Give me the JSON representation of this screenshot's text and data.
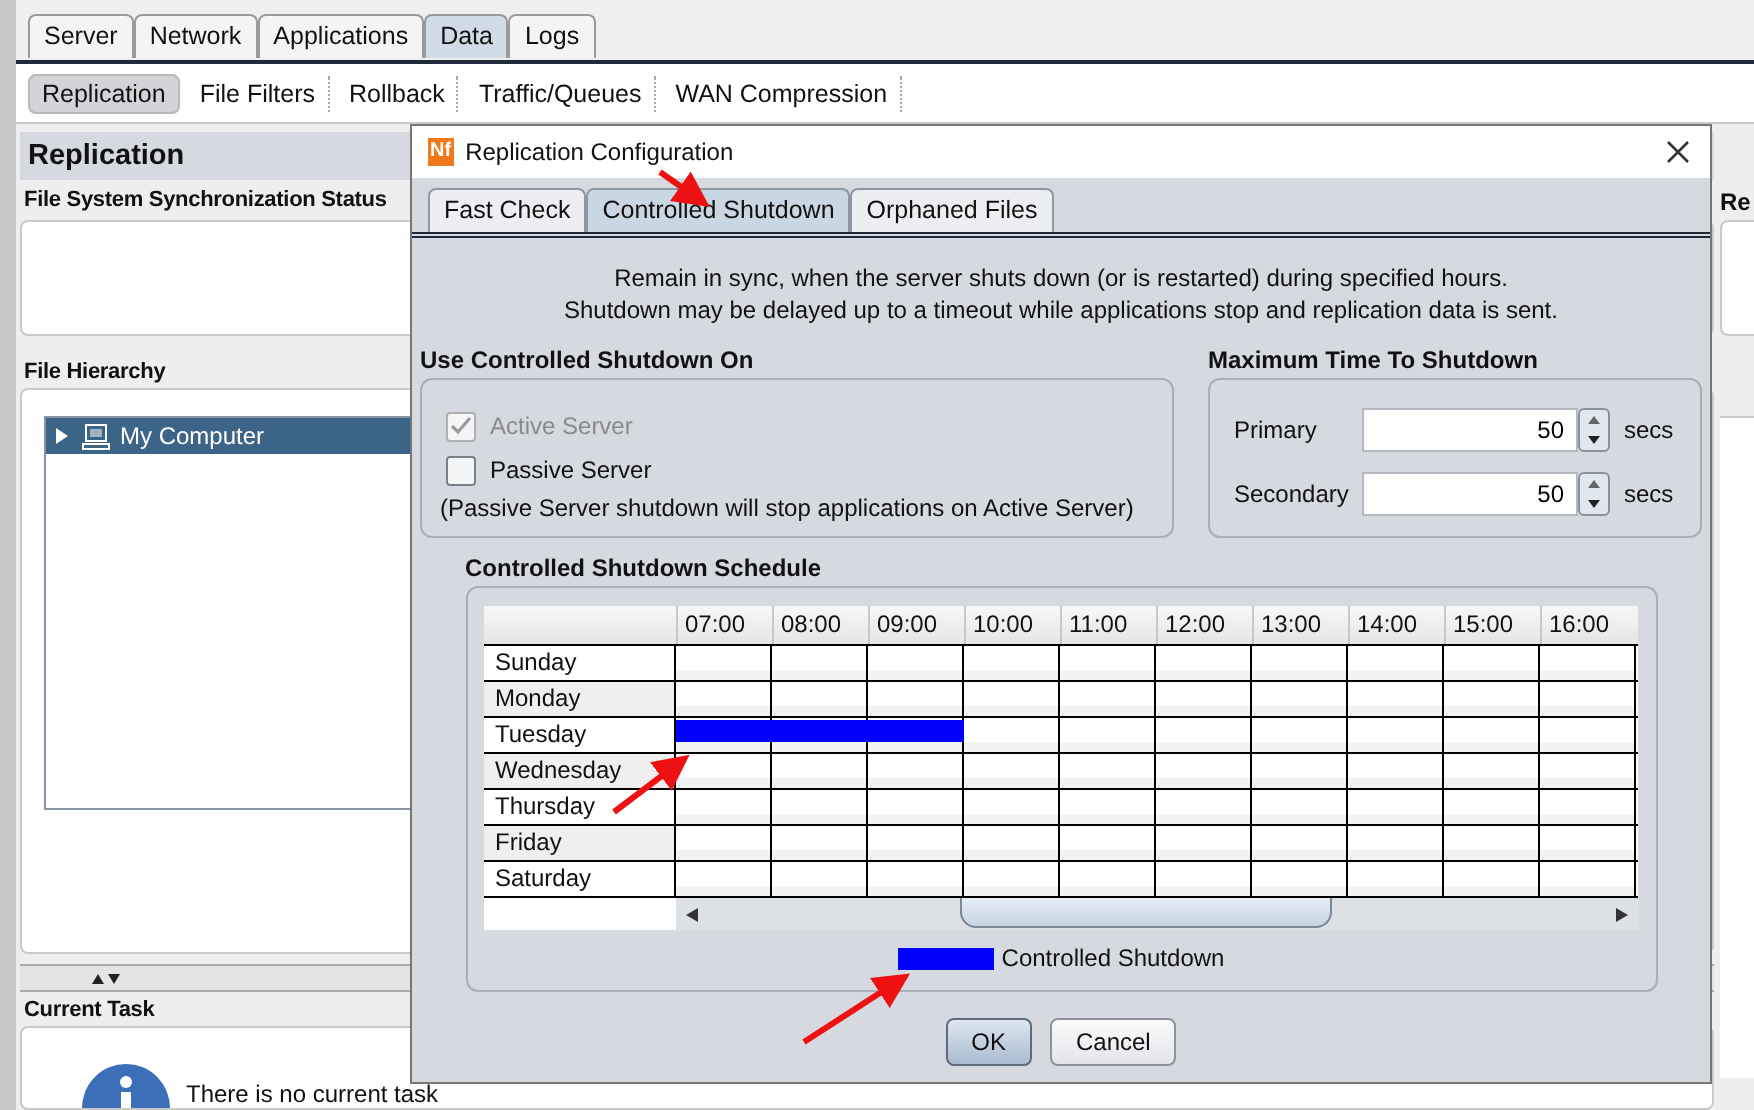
{
  "main_tabs": [
    {
      "label": "Server",
      "selected": false
    },
    {
      "label": "Network",
      "selected": false
    },
    {
      "label": "Applications",
      "selected": false
    },
    {
      "label": "Data",
      "selected": true
    },
    {
      "label": "Logs",
      "selected": false
    }
  ],
  "sub_tabs": [
    {
      "label": "Replication",
      "selected": true
    },
    {
      "label": "File Filters",
      "selected": false
    },
    {
      "label": "Rollback",
      "selected": false
    },
    {
      "label": "Traffic/Queues",
      "selected": false
    },
    {
      "label": "WAN Compression",
      "selected": false
    }
  ],
  "panel": {
    "title": "Replication",
    "sync_status_title": "File System Synchronization Status",
    "hierarchy_title": "File Hierarchy",
    "tree": [
      {
        "label": "My Computer",
        "selected": true,
        "expanded": false
      }
    ],
    "current_task_title": "Current Task",
    "current_task_message": "There is no current task"
  },
  "right_panel": {
    "title": "Re"
  },
  "dialog": {
    "app_icon_text": "Nf",
    "title": "Replication Configuration",
    "tabs": [
      {
        "label": "Fast Check",
        "selected": false
      },
      {
        "label": "Controlled Shutdown",
        "selected": true
      },
      {
        "label": "Orphaned Files",
        "selected": false
      }
    ],
    "description": [
      "Remain in sync, when the server shuts down (or is restarted) during specified hours.",
      "Shutdown may be delayed up to a timeout while applications stop and replication data is sent."
    ],
    "use_on": {
      "title": "Use Controlled Shutdown On",
      "options": [
        {
          "label": "Active Server",
          "checked": true,
          "disabled": true
        },
        {
          "label": "Passive Server",
          "checked": false,
          "disabled": false
        }
      ],
      "note": "(Passive Server shutdown will stop applications on Active Server)"
    },
    "max_time": {
      "title": "Maximum Time To Shutdown",
      "fields": [
        {
          "label": "Primary",
          "value": "50",
          "unit": "secs"
        },
        {
          "label": "Secondary",
          "value": "50",
          "unit": "secs"
        }
      ]
    },
    "schedule": {
      "title": "Controlled Shutdown Schedule",
      "hours": [
        "07:00",
        "08:00",
        "09:00",
        "10:00",
        "11:00",
        "12:00",
        "13:00",
        "14:00",
        "15:00",
        "16:00"
      ],
      "rows": [
        {
          "day": "Sunday",
          "slots": [
            false,
            false,
            false,
            false,
            false,
            false,
            false,
            false,
            false,
            false
          ]
        },
        {
          "day": "Monday",
          "slots": [
            false,
            false,
            false,
            false,
            false,
            false,
            false,
            false,
            false,
            false
          ]
        },
        {
          "day": "Tuesday",
          "slots": [
            true,
            true,
            true,
            false,
            false,
            false,
            false,
            false,
            false,
            false
          ]
        },
        {
          "day": "Wednesday",
          "slots": [
            false,
            false,
            false,
            false,
            false,
            false,
            false,
            false,
            false,
            false
          ]
        },
        {
          "day": "Thursday",
          "slots": [
            false,
            false,
            false,
            false,
            false,
            false,
            false,
            false,
            false,
            false
          ]
        },
        {
          "day": "Friday",
          "slots": [
            false,
            false,
            false,
            false,
            false,
            false,
            false,
            false,
            false,
            false
          ]
        },
        {
          "day": "Saturday",
          "slots": [
            false,
            false,
            false,
            false,
            false,
            false,
            false,
            false,
            false,
            false
          ]
        }
      ],
      "legend": {
        "label": "Controlled Shutdown",
        "color": "#0000ff"
      }
    },
    "buttons": [
      {
        "label": "OK",
        "default": true
      },
      {
        "label": "Cancel",
        "default": false
      }
    ]
  }
}
